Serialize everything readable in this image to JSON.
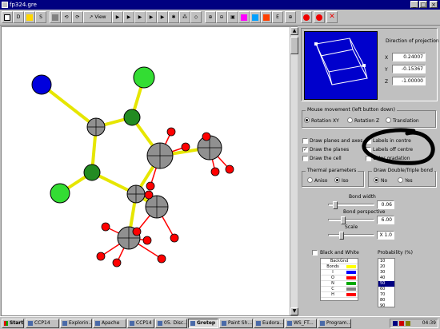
{
  "window": {
    "title": "fp324.gre"
  },
  "toolbar": {
    "btn_d_label": "D",
    "btn_s_label": "S",
    "btn_view_label": "View",
    "btn_e_label": "E"
  },
  "projection": {
    "title": "Direction of projection",
    "x_label": "X",
    "x_value": "0.24007",
    "y_label": "Y",
    "y_value": "-0.15367",
    "z_label": "Z",
    "z_value": "-1.00000"
  },
  "mouse": {
    "caption": "Mouse movement (left button down)",
    "options": [
      "Rotation XY",
      "Rotation Z",
      "Translation"
    ],
    "selected": "Rotation XY"
  },
  "draw": {
    "planes_axes": "Draw planes and axes",
    "planes": "Draw the planes",
    "cell": "Draw the cell",
    "labels_centre": "Labels in centre",
    "labels_off_centre": "Labels off centre",
    "color_gradation": "Color gradation"
  },
  "thermal": {
    "caption": "Thermal parameters",
    "options": [
      "Aniso",
      "Iso"
    ],
    "selected": "Iso"
  },
  "double_bond": {
    "caption": "Draw Double/Triple bond",
    "options": [
      "No",
      "Yes"
    ],
    "selected": "No"
  },
  "bond_width": {
    "label": "Bond width",
    "value": "0.06"
  },
  "bond_perspective": {
    "label": "Bond perspective",
    "value": "6.00"
  },
  "scale": {
    "label": "Scale",
    "value": "X 1.0"
  },
  "black_white": {
    "label": "Black and White"
  },
  "legend": {
    "header1": "BackGnd",
    "header2": "Bonds",
    "rows": [
      {
        "label": "I",
        "color": "#0000ff"
      },
      {
        "label": "O",
        "color": "#ff0000"
      },
      {
        "label": "N",
        "color": "#00aa00"
      },
      {
        "label": "C",
        "color": "#808080"
      },
      {
        "label": "H",
        "color": "#ff0000"
      }
    ]
  },
  "probability": {
    "label": "Probability (%)",
    "items": [
      "10",
      "20",
      "30",
      "40",
      "50",
      "60",
      "70",
      "80",
      "90"
    ],
    "selected": "50"
  },
  "taskbar": {
    "start": "Start",
    "tasks": [
      "CCP14",
      "Explorin...",
      "Apache",
      "CCP14",
      "05. Disc...",
      "Gretep",
      "Paint Sh...",
      "Eudora...",
      "WS_FT...",
      "Program..."
    ],
    "active": "Gretep",
    "clock": "04:39"
  },
  "colors": {
    "accent": "#000080",
    "carbon": "#808080",
    "oxygen": "#ff0000",
    "nitrogen": "#228b22",
    "chlorine": "#22cc22",
    "iodine": "#0000dd",
    "bond": "#ffff00"
  }
}
